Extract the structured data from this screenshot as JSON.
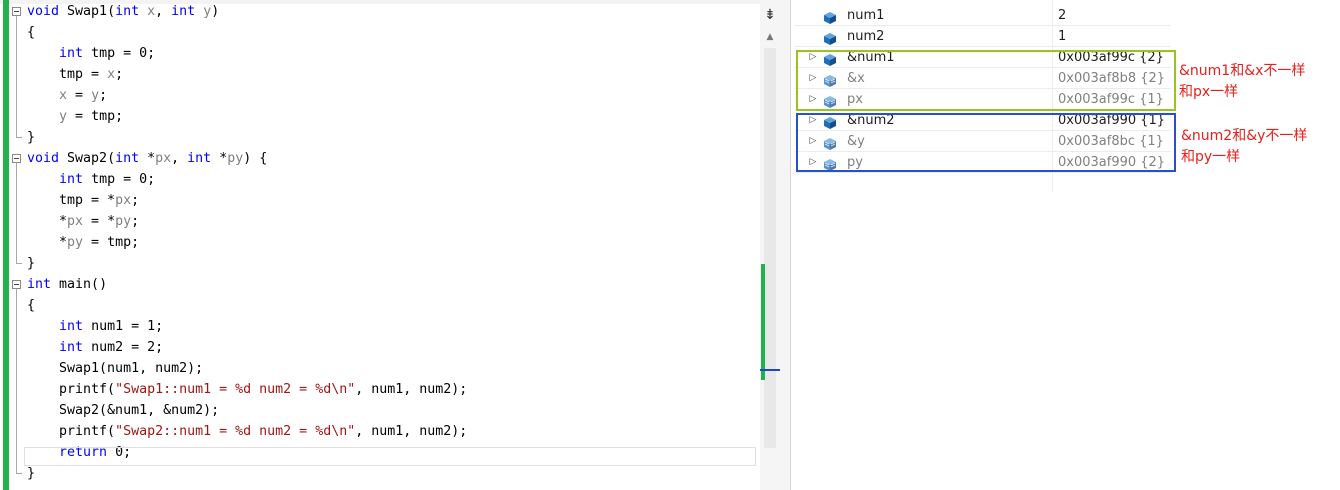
{
  "editor": {
    "lines": [
      [
        [
          "kw",
          "void"
        ],
        [
          "t",
          " Swap1("
        ],
        [
          "kw",
          "int"
        ],
        [
          "t",
          " "
        ],
        [
          "prm",
          "x"
        ],
        [
          "t",
          ", "
        ],
        [
          "kw",
          "int"
        ],
        [
          "t",
          " "
        ],
        [
          "prm",
          "y"
        ],
        [
          "t",
          ")"
        ]
      ],
      [
        [
          "t",
          "{"
        ]
      ],
      [
        [
          "t",
          "    "
        ],
        [
          "kw",
          "int"
        ],
        [
          "t",
          " tmp = 0;"
        ]
      ],
      [
        [
          "t",
          "    tmp = "
        ],
        [
          "prm",
          "x"
        ],
        [
          "t",
          ";"
        ]
      ],
      [
        [
          "t",
          "    "
        ],
        [
          "prm",
          "x"
        ],
        [
          "t",
          " = "
        ],
        [
          "prm",
          "y"
        ],
        [
          "t",
          ";"
        ]
      ],
      [
        [
          "t",
          "    "
        ],
        [
          "prm",
          "y"
        ],
        [
          "t",
          " = tmp;"
        ]
      ],
      [
        [
          "t",
          "}"
        ]
      ],
      [
        [
          "kw",
          "void"
        ],
        [
          "t",
          " Swap2("
        ],
        [
          "kw",
          "int"
        ],
        [
          "t",
          " *"
        ],
        [
          "prm",
          "px"
        ],
        [
          "t",
          ", "
        ],
        [
          "kw",
          "int"
        ],
        [
          "t",
          " *"
        ],
        [
          "prm",
          "py"
        ],
        [
          "t",
          ") {"
        ]
      ],
      [
        [
          "t",
          "    "
        ],
        [
          "kw",
          "int"
        ],
        [
          "t",
          " tmp = 0;"
        ]
      ],
      [
        [
          "t",
          "    tmp = *"
        ],
        [
          "prm",
          "px"
        ],
        [
          "t",
          ";"
        ]
      ],
      [
        [
          "t",
          "    *"
        ],
        [
          "prm",
          "px"
        ],
        [
          "t",
          " = *"
        ],
        [
          "prm",
          "py"
        ],
        [
          "t",
          ";"
        ]
      ],
      [
        [
          "t",
          "    *"
        ],
        [
          "prm",
          "py"
        ],
        [
          "t",
          " = tmp;"
        ]
      ],
      [
        [
          "t",
          "}"
        ]
      ],
      [
        [
          "kw",
          "int"
        ],
        [
          "t",
          " main()"
        ]
      ],
      [
        [
          "t",
          "{"
        ]
      ],
      [
        [
          "t",
          "    "
        ],
        [
          "kw",
          "int"
        ],
        [
          "t",
          " num1 = 1;"
        ]
      ],
      [
        [
          "t",
          "    "
        ],
        [
          "kw",
          "int"
        ],
        [
          "t",
          " num2 = 2;"
        ]
      ],
      [
        [
          "t",
          "    Swap1(num1, num2);"
        ]
      ],
      [
        [
          "t",
          "    printf("
        ],
        [
          "str",
          "\"Swap1::num1 = %d num2 = %d\\n\""
        ],
        [
          "t",
          ", num1, num2);"
        ]
      ],
      [
        [
          "t",
          "    Swap2(&num1, &num2);"
        ]
      ],
      [
        [
          "t",
          "    printf("
        ],
        [
          "str",
          "\"Swap2::num1 = %d num2 = %d\\n\""
        ],
        [
          "t",
          ", num1, num2);"
        ]
      ],
      [
        [
          "t",
          "    "
        ],
        [
          "kw",
          "return"
        ],
        [
          "t",
          " 0;"
        ]
      ],
      [
        [
          "t",
          "}"
        ]
      ]
    ]
  },
  "watch": {
    "rows": [
      {
        "name": "num1",
        "value": "2",
        "expandable": false,
        "dim": false
      },
      {
        "name": "num2",
        "value": "1",
        "expandable": false,
        "dim": false
      },
      {
        "name": "&num1",
        "value": "0x003af99c {2}",
        "expandable": true,
        "dim": false
      },
      {
        "name": "&x",
        "value": "0x003af8b8 {2}",
        "expandable": true,
        "dim": true
      },
      {
        "name": "px",
        "value": "0x003af99c {1}",
        "expandable": true,
        "dim": true
      },
      {
        "name": "&num2",
        "value": "0x003af990 {1}",
        "expandable": true,
        "dim": false
      },
      {
        "name": "&y",
        "value": "0x003af8bc {1}",
        "expandable": true,
        "dim": true
      },
      {
        "name": "py",
        "value": "0x003af990 {2}",
        "expandable": true,
        "dim": true
      }
    ]
  },
  "annotations": {
    "note1_line1": "&num1和&x不一样",
    "note1_line2": "和px一样",
    "note2_line1": "&num2和&y不一样",
    "note2_line2": "和py一样"
  },
  "colors": {
    "keyword": "#0000ff",
    "parameter": "#808080",
    "string": "#a31515",
    "change_bar": "#22b14c",
    "box1": "#9ac31c",
    "box2": "#2850c8",
    "annotation": "#e8201a",
    "cube": "#1e6fb8"
  },
  "icons": {
    "fold": "collapse-minus-icon",
    "expander": "expand-triangle-icon",
    "variable": "variable-cube-icon",
    "split": "split-editor-icon"
  }
}
